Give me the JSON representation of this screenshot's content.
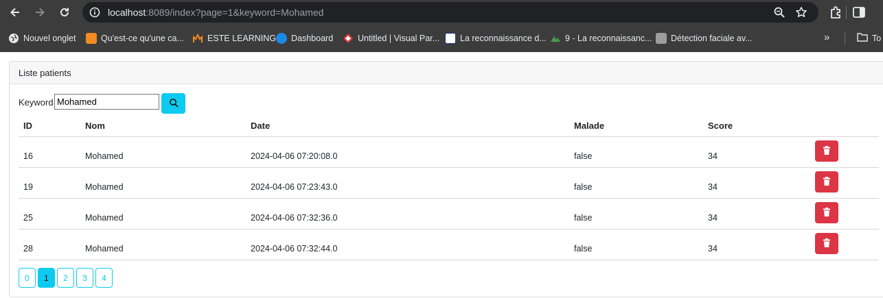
{
  "browser": {
    "url_host": "localhost",
    "url_rest": ":8089/index?page=1&keyword=Mohamed",
    "bookmarks": [
      {
        "label": "Nouvel onglet",
        "color": "#e8eaed"
      },
      {
        "label": "Qu'est-ce qu'une ca...",
        "color": "#f28b24"
      },
      {
        "label": "ESTE LEARNING",
        "color": "#f28b24"
      },
      {
        "label": "Dashboard",
        "color": "#1e88e5"
      },
      {
        "label": "Untitled | Visual Par...",
        "color": "#e53935"
      },
      {
        "label": "La reconnaissance d...",
        "color": "#ffffff"
      },
      {
        "label": "9 - La reconnaissanc...",
        "color": "#43a047"
      },
      {
        "label": "Détection faciale av...",
        "color": "#9e9e9e"
      }
    ],
    "more_bookmarks": "»",
    "folder_label": "To"
  },
  "page": {
    "card_title": "Liste patients",
    "search": {
      "label": "Keyword",
      "value": "Mohamed"
    },
    "columns": [
      "ID",
      "Nom",
      "Date",
      "Malade",
      "Score"
    ],
    "rows": [
      {
        "id": "16",
        "nom": "Mohamed",
        "date": "2024-04-06 07:20:08.0",
        "malade": "false",
        "score": "34"
      },
      {
        "id": "19",
        "nom": "Mohamed",
        "date": "2024-04-06 07:23:43.0",
        "malade": "false",
        "score": "34"
      },
      {
        "id": "25",
        "nom": "Mohamed",
        "date": "2024-04-06 07:32:36.0",
        "malade": "false",
        "score": "34"
      },
      {
        "id": "28",
        "nom": "Mohamed",
        "date": "2024-04-06 07:32:44.0",
        "malade": "false",
        "score": "34"
      }
    ],
    "pages": [
      "0",
      "1",
      "2",
      "3",
      "4"
    ],
    "current_page": "1"
  },
  "colors": {
    "accent": "#0dcaf0",
    "danger": "#dc3545"
  }
}
